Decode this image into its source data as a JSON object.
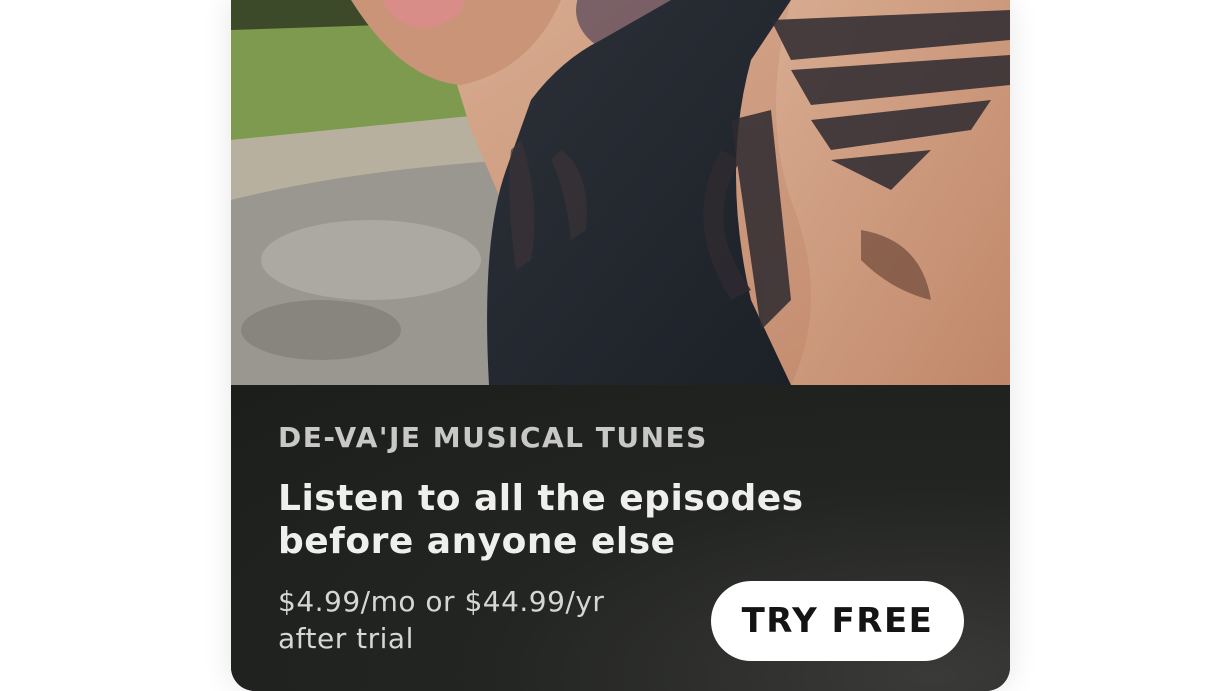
{
  "subscription_offer": {
    "show_name": "DE-VA'JE MUSICAL TUNES",
    "headline": "Listen to all the episodes before anyone else",
    "price_text": "$4.99/mo or $44.99/yr after trial",
    "button_label": "TRY FREE"
  },
  "colors": {
    "card_background": "#1f2120",
    "button_background": "#ffffff",
    "button_text": "#141414",
    "headline_text": "#efefed",
    "show_name_text": "#c8c8c6"
  }
}
